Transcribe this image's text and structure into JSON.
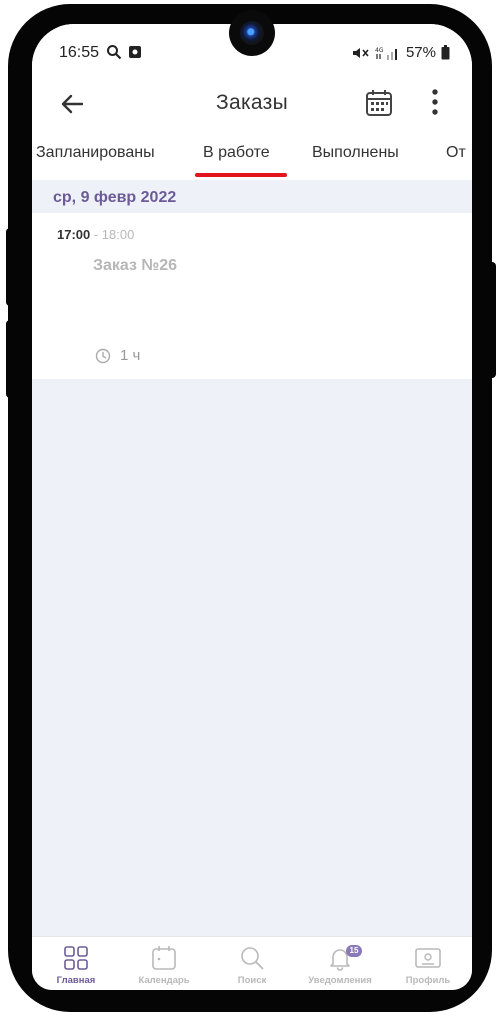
{
  "status_bar": {
    "time": "16:55",
    "battery": "57%"
  },
  "header": {
    "title": "Заказы"
  },
  "tabs": [
    {
      "label": "Запланированы"
    },
    {
      "label": "В работе"
    },
    {
      "label": "Выполнены"
    },
    {
      "label": "От"
    }
  ],
  "date_header": "ср, 9 февр 2022",
  "order": {
    "start_time": "17:00",
    "end_time": " - 18:00",
    "title": "Заказ №26",
    "duration": "1 ч"
  },
  "bottom_nav": [
    {
      "label": "Главная",
      "icon": "grid-icon"
    },
    {
      "label": "Календарь",
      "icon": "calendar-icon"
    },
    {
      "label": "Поиск",
      "icon": "search-icon"
    },
    {
      "label": "Уведомления",
      "icon": "bell-icon",
      "badge": "15"
    },
    {
      "label": "Профиль",
      "icon": "profile-card-icon"
    }
  ],
  "colors": {
    "accent": "#6c5b97",
    "tab_indicator": "#e2151d",
    "background": "#eef2f8"
  }
}
